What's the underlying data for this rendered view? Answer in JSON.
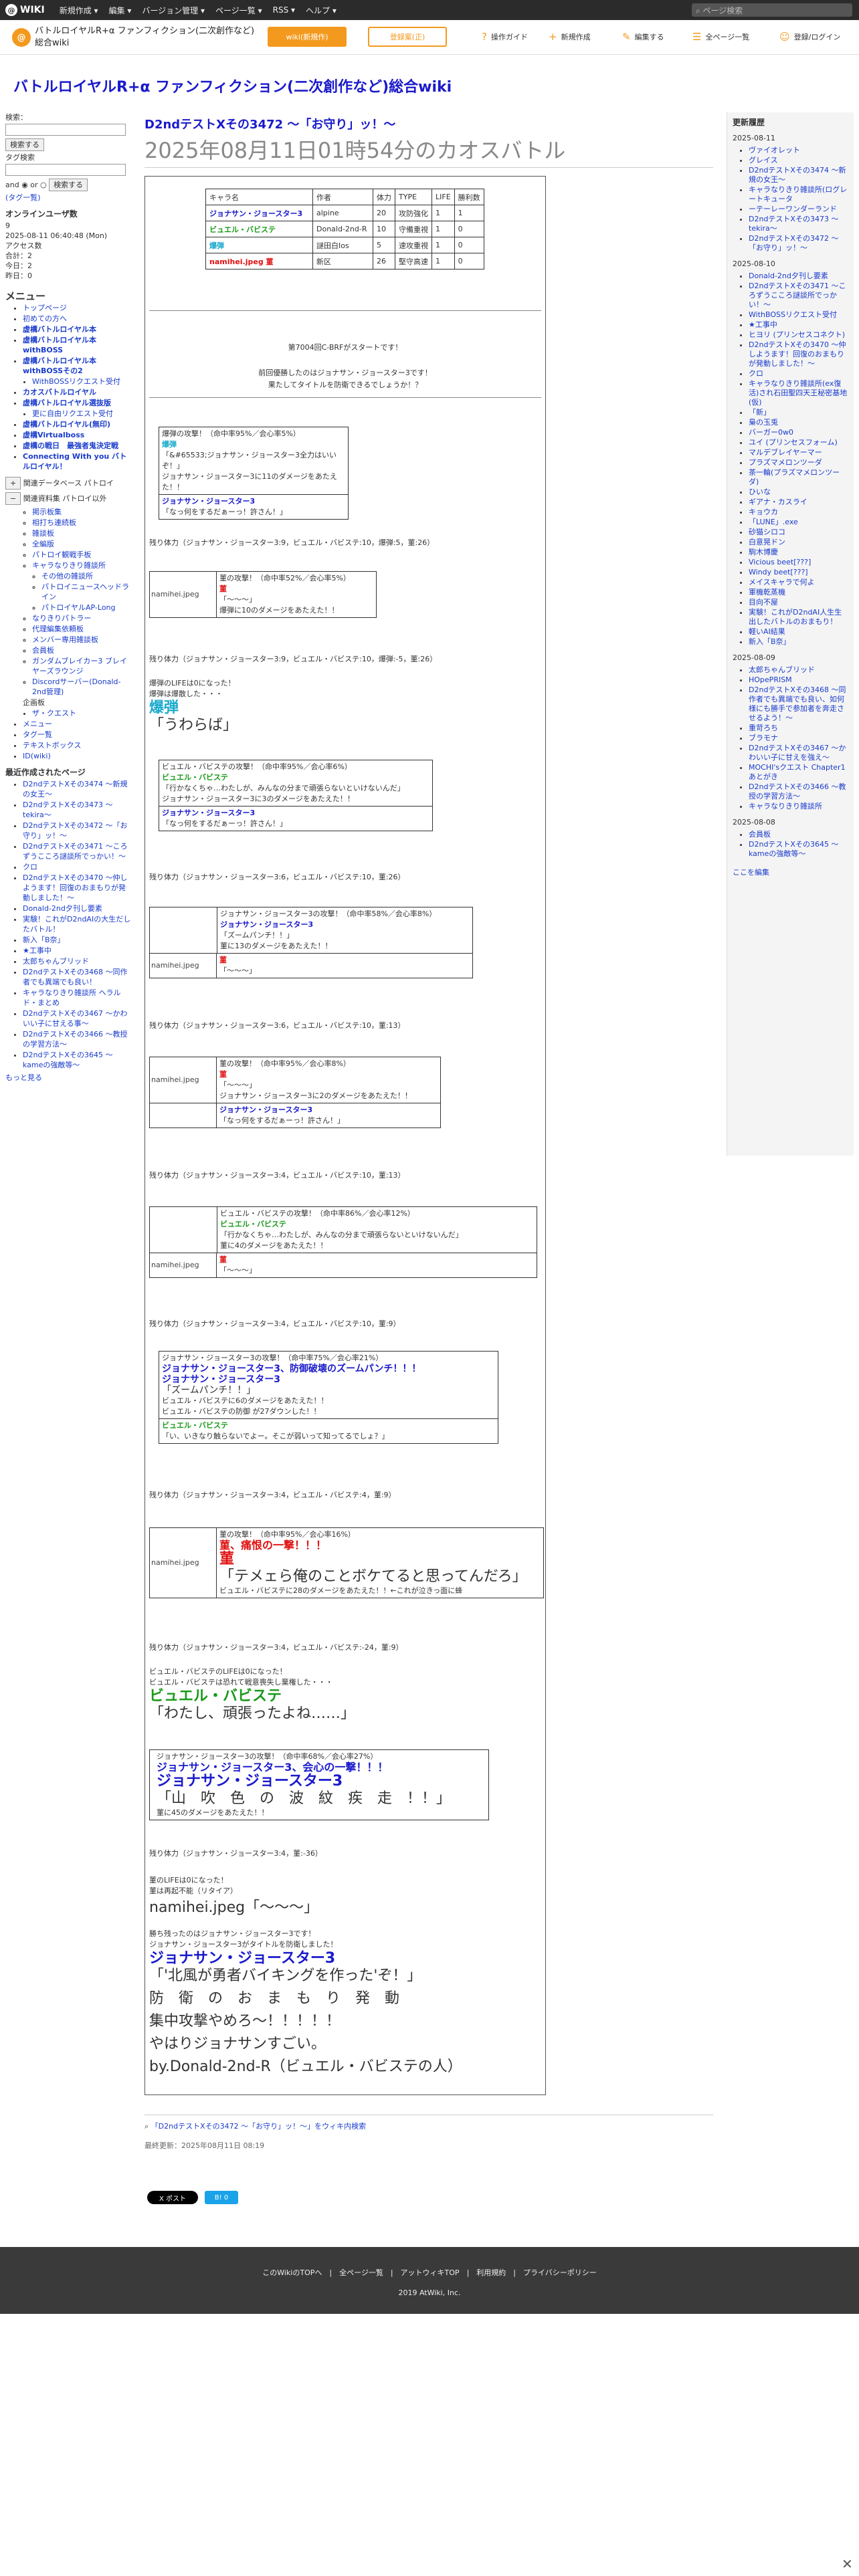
{
  "topbar": {
    "logo": "WIKI",
    "menus": [
      "新規作成 ▾",
      "編集 ▾",
      "バージョン管理 ▾",
      "ページ一覧 ▾",
      "RSS ▾",
      "ヘルプ ▾"
    ],
    "search_placeholder": "ページ検索"
  },
  "site": {
    "title": "バトルロイヤルR+α ファンフィクション(二次創作など)総合wiki",
    "wiki_btn": "wiki(新規作)",
    "reg_btn": "登録案(正)",
    "nav": [
      {
        "icon": "?",
        "label": "操作ガイド"
      },
      {
        "icon": "+",
        "label": "新規作成"
      },
      {
        "icon": "✎",
        "label": "編集する"
      },
      {
        "icon": "☰",
        "label": "全ページ一覧"
      },
      {
        "icon": "☺",
        "label": "登録/ログイン"
      }
    ]
  },
  "wiki_title": "バトルロイヤルR+α ファンフィクション(二次創作など)総合wiki",
  "left": {
    "search_label": "検索：",
    "search_btn": "検索する",
    "tag_label": "タグ検索",
    "and_or": "and ◉ or ○",
    "search_btn2": "検索する",
    "tag_link": "(タグ一覧)",
    "online_title": "オンラインユーザ数",
    "online": [
      "9",
      "2025-08-11 06:40:48 (Mon)",
      "アクセス数",
      "合計：2",
      "今日：2",
      "昨日：0"
    ],
    "menu_title": "メニュー",
    "menu": [
      {
        "t": "トップページ",
        "b": false
      },
      {
        "t": "初めての方へ",
        "b": false
      },
      {
        "t": "虚構バトルロイヤル本",
        "b": true
      },
      {
        "t": "虚構バトルロイヤル本withBOSS",
        "b": true
      },
      {
        "t": "虚構バトルロイヤル本withBOSSその2",
        "b": true
      },
      {
        "t": "WithBOSSリクエスト受付",
        "b": false
      },
      {
        "t": "カオスバトルロイヤル",
        "b": true
      },
      {
        "t": "虚構バトルロイヤル選抜版",
        "b": true
      },
      {
        "t": "更に自由リクエスト受付",
        "b": false
      },
      {
        "t": "虚構バトルロイヤル(無印)",
        "b": true
      },
      {
        "t": "虚構Virtualboss",
        "b": true
      },
      {
        "t": "虚構の戦日　最強者鬼決定戦",
        "b": true
      },
      {
        "t": "Connecting With you バトルロイヤル！",
        "b": true
      }
    ],
    "toggle1": "関連データベース パトロイ",
    "toggle2": "関連資料集 パトロイ以外",
    "subs": [
      "掲示板集",
      "相打ち連続板",
      "雑談板",
      "全編版",
      "パトロイ観戦手板",
      "キャラなりきり雑談所",
      "その他の雑談所",
      "パトロイニュースヘッドライン",
      "パトロイヤルAP-Long",
      "なりきりパトラー",
      "代理編集依頼板",
      "メンバー専用雑談板",
      "会員板",
      "ガンダムブレイカー3 ブレイヤーズラウンジ",
      "Discordサーバー(Donald-2nd管理)"
    ],
    "mini_title": "企画板",
    "mini": [
      "ザ・クエスト"
    ],
    "small": [
      "メニュー",
      "タグ一覧",
      "テキストボックス",
      "ID(wiki)"
    ],
    "recent_title": "最近作成されたページ",
    "recent": [
      "D2ndテストXその3474 〜新規の女王〜",
      "D2ndテストXその3473 〜tekira〜",
      "D2ndテストXその3472 〜「お守り」ッ！〜",
      "D2ndテストXその3471 〜ころずうこころ謎談所でっかい！〜",
      "クロ",
      "D2ndテストXその3470 〜仲しようます！回復のおまもりが発動しました！〜",
      "Donald-2nd夕刊し要素",
      "実験！これがD2ndAIの大生だしたバトル！",
      "新入「B奈」",
      "★工事中",
      "太郎ちゃんブリッド",
      "D2ndテストXその3468 〜同作者でも異端でも良い！",
      "キャラなりきり雑談所 ヘラルド・まとめ",
      "D2ndテストXその3467 〜かわいい子に甘える事〜",
      "D2ndテストXその3466 〜教授の学習方法〜",
      "D2ndテストXその3645 〜kameの強敵等〜"
    ],
    "more": "もっと見る"
  },
  "right": {
    "title": "更新履歴",
    "groups": [
      {
        "date": "2025-08-11",
        "items": [
          "ヴァイオレット",
          "グレイス",
          "D2ndテストXその3474 〜新規の女王〜",
          "キャラなりきり雑談所(ログレートキュータ",
          "ーテーレーワンダーランド",
          "D2ndテストXその3473 〜tekira〜",
          "D2ndテストXその3472 〜「お守り」ッ！〜"
        ]
      },
      {
        "date": "2025-08-10",
        "items": [
          "Donald-2nd夕刊し要素",
          "D2ndテストXその3471 〜ころずうこころ謎談所でっかい！〜",
          "WithBOSSリクエスト受付",
          "★工事中",
          "ヒヨリ (プリンセスコネクト)",
          "D2ndテストXその3470 〜仲しようます！回復のおまもりが発動しました！〜",
          "クロ",
          "キャラなりきり雑談所(ex復活)され石田聖四天王秘密基地(仮)",
          "「新」",
          "梟の玉兎",
          "バーガー0w0",
          "ユイ (プリンセスフォーム)",
          "マルデブレイヤーマー",
          "プラズマメロンツーダ",
          "茶一輪(プラズマメロンツーダ)",
          "ひいな",
          "ギアナ・カスライ",
          "キョウカ",
          "「LUNE」.exe",
          "砂猫シロコ",
          "白意晃ドン",
          "駒木博慶",
          "Vicious beet[???]",
          "Windy beet[???]",
          "メイスキャラで何よ",
          "軍機乾蒸機",
          "目向不屋",
          "実験！これがD2ndAI人生生出したバトルのおまもり！",
          "軽いAI結果",
          "新入「B奈」"
        ]
      },
      {
        "date": "2025-08-09",
        "items": [
          "太郎ちゃんブリッド",
          "HOpePRISM",
          "D2ndテストXその3468 〜同作者でも異端でも良い、如何様にも勝手で参加者を奔走させるよう！〜",
          "重苛ろち",
          "ブラモナ",
          "D2ndテストXその3467 〜かわいい子に甘えを強え〜",
          "MOCHI'sクエスト Chapter1 あとがき",
          "D2ndテストXその3466 〜教授の学習方法〜",
          "キャラなりきり雑談所"
        ]
      },
      {
        "date": "2025-08-08",
        "items": [
          "会員板",
          "D2ndテストXその3645 〜kameの強敵等〜"
        ]
      }
    ],
    "edit": "ここを編集"
  },
  "page": {
    "h1": "D2ndテストXその3472 〜「お守り」ッ！〜",
    "h2": "2025年08月11日01時54分のカオスバトル",
    "table_header": [
      "キャラ名",
      "作者",
      "体力",
      "TYPE",
      "LIFE",
      "勝利数"
    ],
    "table_rows": [
      {
        "name": "ジョナサン・ジョースター3",
        "author": "alpine",
        "hp": "20",
        "type": "攻防強化",
        "life": "1",
        "wins": "1",
        "cls": "blue"
      },
      {
        "name": "ビュエル・バビステ",
        "author": "Donald-2nd-R",
        "hp": "10",
        "type": "守備重視",
        "life": "1",
        "wins": "0",
        "cls": "green"
      },
      {
        "name": "爆弾",
        "author": "謎田白Ios",
        "hp": "5",
        "type": "速攻重視",
        "life": "1",
        "wins": "0",
        "cls": "cyan"
      },
      {
        "name": "namihei.jpeg 菫",
        "author": "新区",
        "hp": "26",
        "type": "堅守高速",
        "life": "1",
        "wins": "0",
        "cls": "red"
      }
    ],
    "intro1": "第7004回C-BRFがスタートです！",
    "intro2": "前回優勝したのはジョナサン・ジョースター3です！",
    "intro3": "果たしてタイトルを防衛できるでしょうか！？",
    "f1": [
      "爆弾の攻撃！（命中率95%／会心率5%）",
      "爆弾",
      "「&#65533;ジョナサン・ジョースター3全力はいいぞ！」",
      "ジョナサン・ジョースター3に11のダメージをあたえた！！",
      "ジョナサン・ジョースター3",
      "「なっ何をするだぁーっ！許さん！」"
    ],
    "r1": "残り体力（ジョナサン・ジョースター3:9，ビュエル・バビステ:10，爆弾:5，菫:26）",
    "f2": [
      "菫の攻撃！（命中率52%／会心率5%）",
      "菫",
      "「〜〜〜」",
      "爆弾に10のダメージをあたえた！！"
    ],
    "f2img": "namihei.jpeg",
    "r2": "残り体力（ジョナサン・ジョースター3:9，ビュエル・バビステ:10，爆弾:-5，菫:26）",
    "d1a": "爆弾のLIFEは0になった！",
    "d1b": "爆弾は爆散した・・・",
    "d1c": "爆弾",
    "d1d": "「うわらば」",
    "f3": [
      "ビュエル・バビステの攻撃！（命中率95%／会心率6%）",
      "ビュエル・バビステ",
      "「行かなくちゃ…わたしが、みんなの分まで頑張らないといけないんだ」",
      "ジョナサン・ジョースター3に3のダメージをあたえた！！",
      "ジョナサン・ジョースター3",
      "「なっ何をするだぁーっ！許さん！」"
    ],
    "r3": "残り体力（ジョナサン・ジョースター3:6，ビュエル・バビステ:10，菫:26）",
    "f4": [
      "ジョナサン・ジョースター3の攻撃！（命中率58%／会心率8%）",
      "ジョナサン・ジョースター3",
      "「ズームパンチ！！」",
      "菫に13のダメージをあたえた！！",
      "菫",
      "「〜〜〜」"
    ],
    "r4": "残り体力（ジョナサン・ジョースター3:6，ビュエル・バビステ:10，菫:13）",
    "f5": [
      "菫の攻撃！（命中率95%／会心率8%）",
      "菫",
      "「〜〜〜」",
      "ジョナサン・ジョースター3に2のダメージをあたえた！！",
      "ジョナサン・ジョースター3",
      "「なっ何をするだぁーっ！許さん！」"
    ],
    "r5": "残り体力（ジョナサン・ジョースター3:4，ビュエル・バビステ:10，菫:13）",
    "f6": [
      "ビュエル・バビステの攻撃！（命中率86%／会心率12%）",
      "ビュエル・バビステ",
      "「行かなくちゃ…わたしが、みんなの分まで頑張らないといけないんだ」",
      "菫に4のダメージをあたえた！！",
      "菫",
      "「〜〜〜」"
    ],
    "r6": "残り体力（ジョナサン・ジョースター3:4，ビュエル・バビステ:10，菫:9）",
    "f7": [
      "ジョナサン・ジョースター3の攻撃！（命中率75%／会心率21%）",
      "ジョナサン・ジョースター3、防御破壊のズームパンチ！！！",
      "ジョナサン・ジョースター3",
      "「ズームパンチ！！」",
      "ビュエル・バビステに6のダメージをあたえた！！",
      "ビュエル・バビステの防御 が27ダウンした！！",
      "ビュエル・バビステ",
      "「い、いきなり触らないでよー。そこが弱いって知ってるでしょ？」"
    ],
    "r7": "残り体力（ジョナサン・ジョースター3:4，ビュエル・バビステ:4，菫:9）",
    "f8": [
      "菫の攻撃！（命中率95%／会心率16%）",
      "菫、痛恨の一撃！！！",
      "菫",
      "「テメェら俺のことボケてると思ってんだろ」",
      "ビュエル・バビステに28のダメージをあたえた！！←これが泣きっ面に蜂"
    ],
    "r8": "残り体力（ジョナサン・ジョースター3:4，ビュエル・バビステ:-24，菫:9）",
    "d2a": "ビュエル・バビステのLIFEは0になった！",
    "d2b": "ビュエル・バビステは恐れて戦意喪失し棄権した・・・",
    "d2c": "ビュエル・バビステ",
    "d2d": "「わたし、頑張ったよね……」",
    "f9": [
      "ジョナサン・ジョースター3の攻撃！（命中率68%／会心率27%）",
      "ジョナサン・ジョースター3、会心の一撃！！！",
      "ジョナサン・ジョースター3",
      "「山　吹　色　の　波　紋　疾　走　！！」",
      "菫に45のダメージをあたえた！！"
    ],
    "r9": "残り体力（ジョナサン・ジョースター3:4，菫:-36）",
    "d3a": "菫のLIFEは0になった！",
    "d3b": "菫は再起不能（リタイア）",
    "d3c": "namihei.jpeg「〜〜〜」",
    "win1": "勝ち残ったのはジョナサン・ジョースター3です！",
    "win2": "ジョナサン・ジョースター3がタイトルを防衛しました！",
    "win3": "ジョナサン・ジョースター3",
    "win4": "「'北風が勇者バイキングを作った'ぞ！」",
    "win5": "防　衛　の　お　ま　も　り　発　動",
    "win6": "集中攻撃やめろ〜！！！！！",
    "win7": "やはりジョナサンすごい。",
    "win8": "by.Donald-2nd-R（ビュエル・バビステの人）",
    "search_link": "「D2ndテストXその3472 〜「お守り」ッ！〜」をウィキ内検索",
    "last_updated": "最終更新：2025年08月11日 08:19",
    "share_x": "X ポスト",
    "share_b": "B! 0"
  },
  "footer": {
    "links": "このWikiのTOPへ　|　全ページ一覧　|　アットウィキTOP　|　利用規約　|　プライバシーポリシー",
    "copy": "2019 AtWiki, Inc."
  },
  "colors": {
    "accent": "#f39a1e",
    "topbar": "#2b2b2b",
    "footer": "#3a3a3a"
  }
}
